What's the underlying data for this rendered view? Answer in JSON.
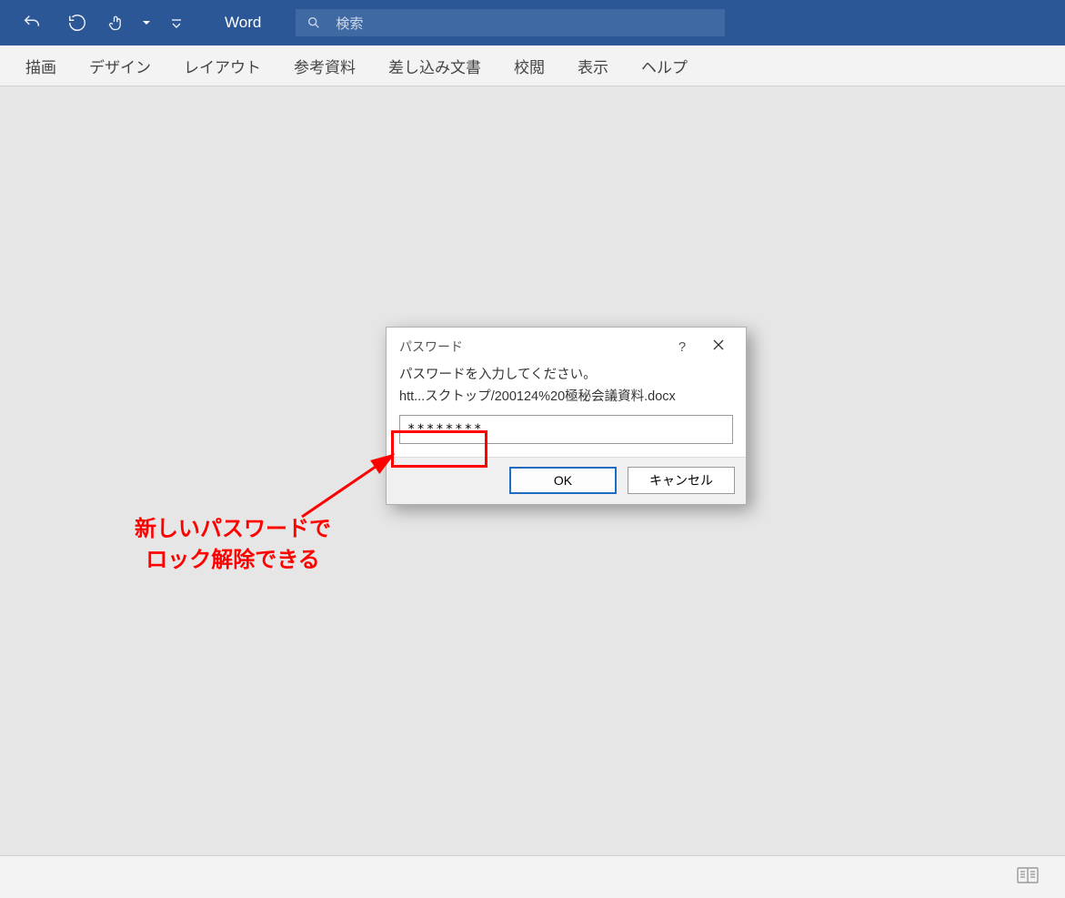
{
  "titlebar": {
    "app_name": "Word",
    "search_placeholder": "検索"
  },
  "ribbon": {
    "tabs": [
      "描画",
      "デザイン",
      "レイアウト",
      "参考資料",
      "差し込み文書",
      "校閲",
      "表示",
      "ヘルプ"
    ]
  },
  "dialog": {
    "title": "パスワード",
    "message": "パスワードを入力してください。",
    "path": "htt...スクトップ/200124%20極秘会議資料.docx",
    "password_value": "********",
    "ok_label": "OK",
    "cancel_label": "キャンセル",
    "help_label": "?"
  },
  "annotation": {
    "text": "新しいパスワードで\nロック解除できる"
  }
}
